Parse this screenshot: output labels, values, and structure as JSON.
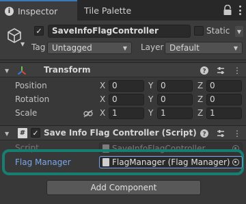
{
  "tabs": [
    {
      "label": "Inspector",
      "active": true
    },
    {
      "label": "Tile Palette",
      "active": false
    }
  ],
  "game_object": {
    "name": "SaveInfoFlagController",
    "active": true,
    "static_label": "Static",
    "static_checked": false,
    "tag_label": "Tag",
    "tag_value": "Untagged",
    "layer_label": "Layer",
    "layer_value": "Default"
  },
  "transform": {
    "title": "Transform",
    "rows": [
      {
        "label": "Position",
        "x": "0",
        "y": "0",
        "z": "0"
      },
      {
        "label": "Rotation",
        "x": "0",
        "y": "0",
        "z": "0"
      },
      {
        "label": "Scale",
        "x": "1",
        "y": "1",
        "z": "1"
      }
    ],
    "axis_labels": {
      "x": "X",
      "y": "Y",
      "z": "Z"
    }
  },
  "script_component": {
    "title": "Save Info Flag Controller (Script)",
    "icon_glyph": "#",
    "enabled": true,
    "script_label": "Script",
    "script_value": "SaveInfoFlagController",
    "field_label": "Flag Manager",
    "field_value": "FlagManager (Flag Manager)"
  },
  "add_component_label": "Add Component",
  "colors": {
    "accent_tab": "#3a79bb",
    "highlight": "#177e72",
    "field_label_blue": "#7aa7e8",
    "transform_x_axis": "#e0453a",
    "transform_y_axis": "#6cc24a",
    "transform_z_axis": "#3a7ce0"
  },
  "icons": {
    "info": "info-icon",
    "lock": "lock-icon",
    "kebab": "kebab-menu-icon",
    "gameobject": "cube-icon",
    "help": "help-icon",
    "presets": "presets-icon",
    "more": "kebab-menu-icon",
    "link": "constrain-proportions-icon",
    "object_picker": "object-picker-icon"
  }
}
